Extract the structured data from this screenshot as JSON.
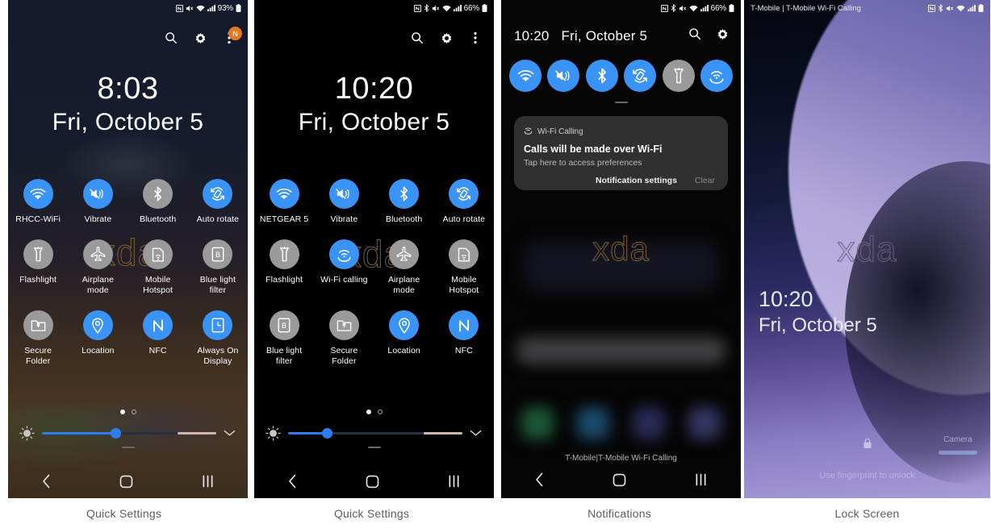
{
  "captions": [
    "Quick Settings",
    "Quick Settings",
    "Notifications",
    "Lock Screen"
  ],
  "colors": {
    "accent_on": "#3a93f7",
    "tile_off": "#9a9a9a",
    "badge": "#e8761f",
    "slider": "#2e7df0",
    "watermark": "#7d6034"
  },
  "watermark": "xda",
  "panel1": {
    "statusbar": {
      "battery_pct": "93%",
      "icons": [
        "nfc-icon",
        "mute-icon",
        "wifi-icon",
        "signal-icon",
        "battery-icon"
      ]
    },
    "actions": [
      {
        "name": "search-icon",
        "label": "Search"
      },
      {
        "name": "gear-icon",
        "label": "Settings"
      },
      {
        "name": "overflow-menu-icon",
        "label": "More",
        "badge": "N"
      }
    ],
    "clock": {
      "time": "8:03",
      "date": "Fri, October 5"
    },
    "tiles": [
      [
        {
          "label": "RHCC-WiFi",
          "icon": "wifi-icon",
          "state": "on"
        },
        {
          "label": "Vibrate",
          "icon": "vibrate-icon",
          "state": "on"
        },
        {
          "label": "Bluetooth",
          "icon": "bluetooth-icon",
          "state": "off"
        },
        {
          "label": "Auto rotate",
          "icon": "auto-rotate-icon",
          "state": "on"
        }
      ],
      [
        {
          "label": "Flashlight",
          "icon": "flashlight-icon",
          "state": "off"
        },
        {
          "label": "Airplane mode",
          "icon": "airplane-icon",
          "state": "off"
        },
        {
          "label": "Mobile Hotspot",
          "icon": "hotspot-icon",
          "state": "off"
        },
        {
          "label": "Blue light filter",
          "icon": "blue-light-filter-icon",
          "state": "off"
        }
      ],
      [
        {
          "label": "Secure Folder",
          "icon": "secure-folder-icon",
          "state": "off"
        },
        {
          "label": "Location",
          "icon": "location-icon",
          "state": "on"
        },
        {
          "label": "NFC",
          "icon": "nfc-icon",
          "state": "on"
        },
        {
          "label": "Always On Display",
          "icon": "always-on-display-icon",
          "state": "on"
        }
      ]
    ],
    "pager": {
      "pages": 2,
      "active": 0
    },
    "brightness": {
      "value": 42,
      "icon": "brightness-icon",
      "expand_icon": "chevron-down-icon"
    },
    "navbar": [
      "back-icon",
      "home-icon",
      "recents-icon"
    ]
  },
  "panel2": {
    "statusbar": {
      "battery_pct": "66%",
      "icons": [
        "nfc-icon",
        "bluetooth-icon",
        "mute-icon",
        "wifi-icon",
        "signal-icon",
        "battery-icon"
      ]
    },
    "actions": [
      {
        "name": "search-icon",
        "label": "Search"
      },
      {
        "name": "gear-icon",
        "label": "Settings"
      },
      {
        "name": "overflow-menu-icon",
        "label": "More"
      }
    ],
    "clock": {
      "time": "10:20",
      "date": "Fri, October 5"
    },
    "tiles": [
      [
        {
          "label": "NETGEAR 5",
          "icon": "wifi-icon",
          "state": "on"
        },
        {
          "label": "Vibrate",
          "icon": "vibrate-icon",
          "state": "on"
        },
        {
          "label": "Bluetooth",
          "icon": "bluetooth-icon",
          "state": "on"
        },
        {
          "label": "Auto rotate",
          "icon": "auto-rotate-icon",
          "state": "on"
        }
      ],
      [
        {
          "label": "Flashlight",
          "icon": "flashlight-icon",
          "state": "off"
        },
        {
          "label": "Wi-Fi calling",
          "icon": "wifi-calling-icon",
          "state": "on"
        },
        {
          "label": "Airplane mode",
          "icon": "airplane-icon",
          "state": "off"
        },
        {
          "label": "Mobile Hotspot",
          "icon": "hotspot-icon",
          "state": "off"
        }
      ],
      [
        {
          "label": "Blue light filter",
          "icon": "blue-light-filter-icon",
          "state": "off"
        },
        {
          "label": "Secure Folder",
          "icon": "secure-folder-icon",
          "state": "off"
        },
        {
          "label": "Location",
          "icon": "location-icon",
          "state": "on"
        },
        {
          "label": "NFC",
          "icon": "nfc-icon",
          "state": "on"
        }
      ]
    ],
    "pager": {
      "pages": 2,
      "active": 0
    },
    "brightness": {
      "value": 22,
      "icon": "brightness-icon",
      "expand_icon": "chevron-down-icon"
    },
    "navbar": [
      "back-icon",
      "home-icon",
      "recents-icon"
    ]
  },
  "panel3": {
    "statusbar": {
      "battery_pct": "66%",
      "icons": [
        "nfc-icon",
        "bluetooth-icon",
        "mute-icon",
        "wifi-icon",
        "signal-icon",
        "battery-icon"
      ]
    },
    "header": {
      "time": "10:20",
      "date": "Fri, October 5"
    },
    "actions": [
      {
        "name": "search-icon",
        "label": "Search"
      },
      {
        "name": "gear-icon",
        "label": "Settings"
      }
    ],
    "toggles": [
      {
        "icon": "wifi-icon",
        "state": "on",
        "label": "Wi-Fi"
      },
      {
        "icon": "vibrate-icon",
        "state": "on",
        "label": "Vibrate"
      },
      {
        "icon": "bluetooth-icon",
        "state": "on",
        "label": "Bluetooth"
      },
      {
        "icon": "auto-rotate-icon",
        "state": "on",
        "label": "Auto rotate"
      },
      {
        "icon": "flashlight-icon",
        "state": "off",
        "label": "Flashlight"
      },
      {
        "icon": "wifi-calling-icon",
        "state": "on",
        "label": "Wi-Fi calling"
      }
    ],
    "notification": {
      "app": "Wi-Fi Calling",
      "app_icon": "wifi-calling-icon",
      "title": "Calls will be made over Wi-Fi",
      "subtitle": "Tap here to access preferences",
      "action_settings": "Notification settings",
      "action_clear": "Clear"
    },
    "carrier": "T-Mobile|T-Mobile Wi-Fi Calling",
    "navbar": [
      "back-icon",
      "home-icon",
      "recents-icon"
    ]
  },
  "panel4": {
    "statusbar": {
      "carrier": "T-Mobile | T-Mobile Wi-Fi Calling",
      "icons": [
        "nfc-icon",
        "bluetooth-icon",
        "mute-icon",
        "wifi-icon",
        "signal-icon",
        "battery-icon"
      ]
    },
    "clock": {
      "time": "10:20",
      "date": "Fri, October 5"
    },
    "lock_icon": "lock-icon",
    "hint": "Use fingerprint to unlock",
    "camera": {
      "label": "Camera",
      "icon": "camera-shortcut-icon"
    }
  }
}
